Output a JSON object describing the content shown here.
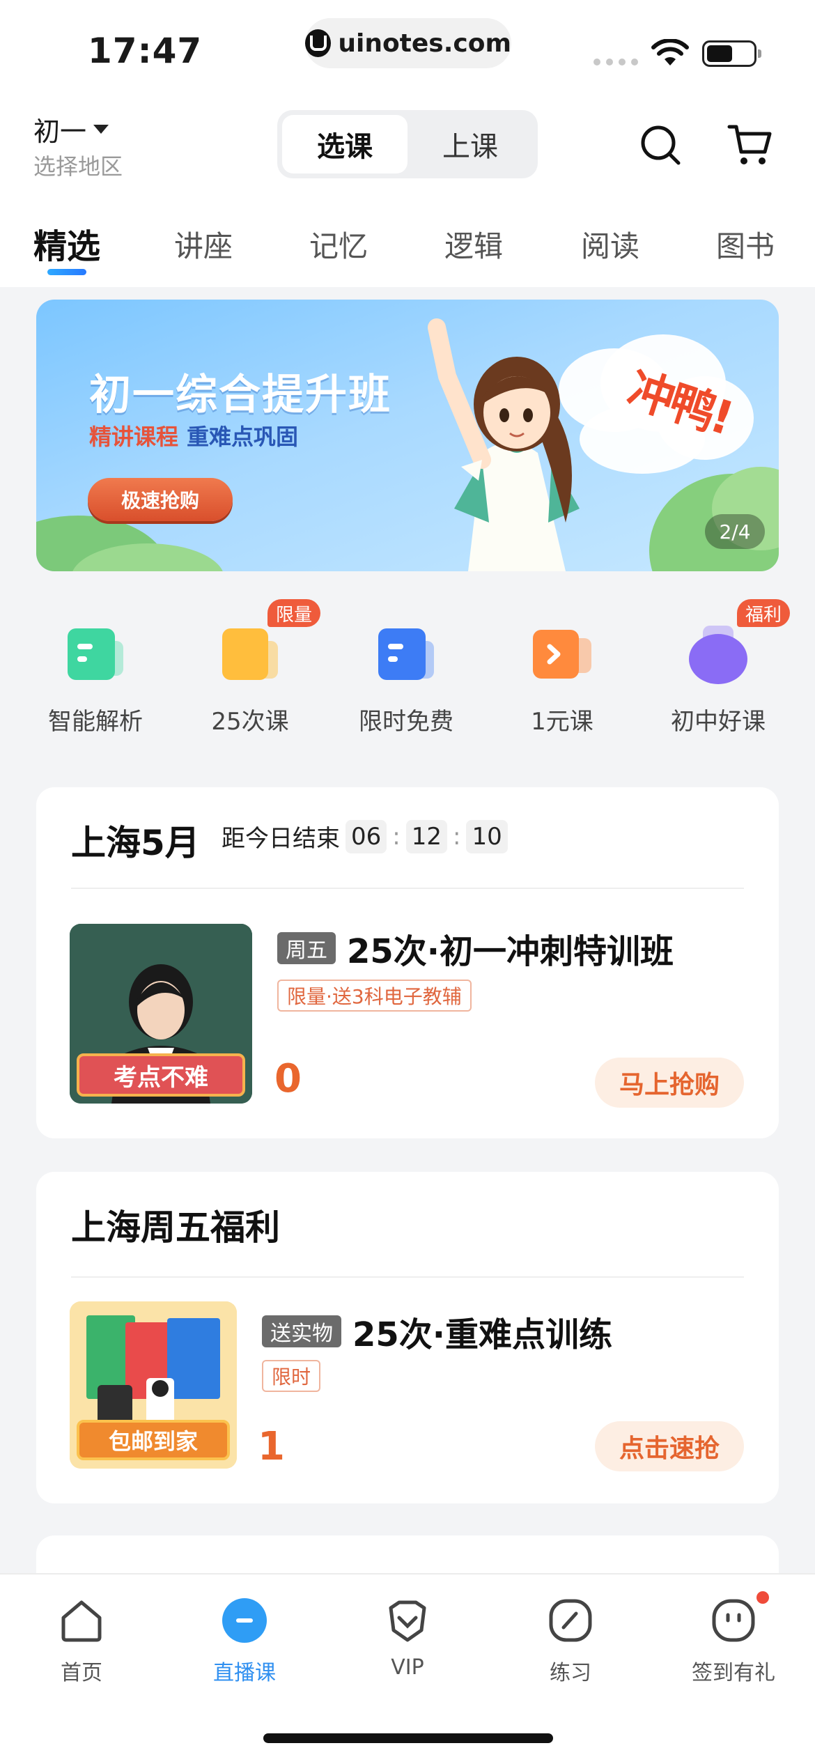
{
  "status_bar": {
    "time": "17:47",
    "url": "uinotes.com"
  },
  "header": {
    "grade": "初一",
    "region": "选择地区",
    "toggle": [
      {
        "label": "选课",
        "active": true
      },
      {
        "label": "上课",
        "active": false
      }
    ]
  },
  "tabs": [
    {
      "label": "精选",
      "active": true
    },
    {
      "label": "讲座"
    },
    {
      "label": "记忆"
    },
    {
      "label": "逻辑"
    },
    {
      "label": "阅读"
    },
    {
      "label": "图书"
    }
  ],
  "banner": {
    "title": "初一综合提升班",
    "subtitle_red": "精讲课程",
    "subtitle_blue": "重难点巩固",
    "button": "极速抢购",
    "slogan": "冲鸭!",
    "page": "2/4"
  },
  "quick_links": [
    {
      "label": "智能解析",
      "icon": "smart-analysis-icon",
      "color": "#3fd6a0",
      "tag": ""
    },
    {
      "label": "25次课",
      "icon": "course-25-icon",
      "color": "#ffbe3d",
      "tag": "限量"
    },
    {
      "label": "限时免费",
      "icon": "free-limited-icon",
      "color": "#3d7cf5",
      "tag": ""
    },
    {
      "label": "1元课",
      "icon": "one-yuan-icon",
      "color": "#ff8a3d",
      "tag": ""
    },
    {
      "label": "初中好课",
      "icon": "good-course-icon",
      "color": "#8a6cf5",
      "tag": "福利"
    }
  ],
  "promo1": {
    "title": "上海5月",
    "countdown_label": "距今日结束",
    "countdown": [
      "06",
      "12",
      "10"
    ],
    "thumb_caption": "考点不难",
    "day_tag": "周五",
    "course_name": "25次·初一冲刺特训班",
    "tag": "限量·送3科电子教辅",
    "price": "0",
    "button": "马上抢购"
  },
  "promo2": {
    "title": "上海周五福利",
    "thumb_caption": "包邮到家",
    "day_tag": "送实物",
    "course_name": "25次·重难点训练",
    "tag": "限时",
    "price": "1",
    "button": "点击速抢"
  },
  "bottom_nav": [
    {
      "label": "首页",
      "icon": "home-icon",
      "active": false
    },
    {
      "label": "直播课",
      "icon": "live-icon",
      "active": true
    },
    {
      "label": "VIP",
      "icon": "vip-icon",
      "active": false
    },
    {
      "label": "练习",
      "icon": "practice-icon",
      "active": false
    },
    {
      "label": "签到有礼",
      "icon": "checkin-icon",
      "active": false
    }
  ],
  "colors": {
    "accent": "#2f8ff0",
    "price": "#e9662d",
    "tag_red": "#ef5b3b"
  }
}
